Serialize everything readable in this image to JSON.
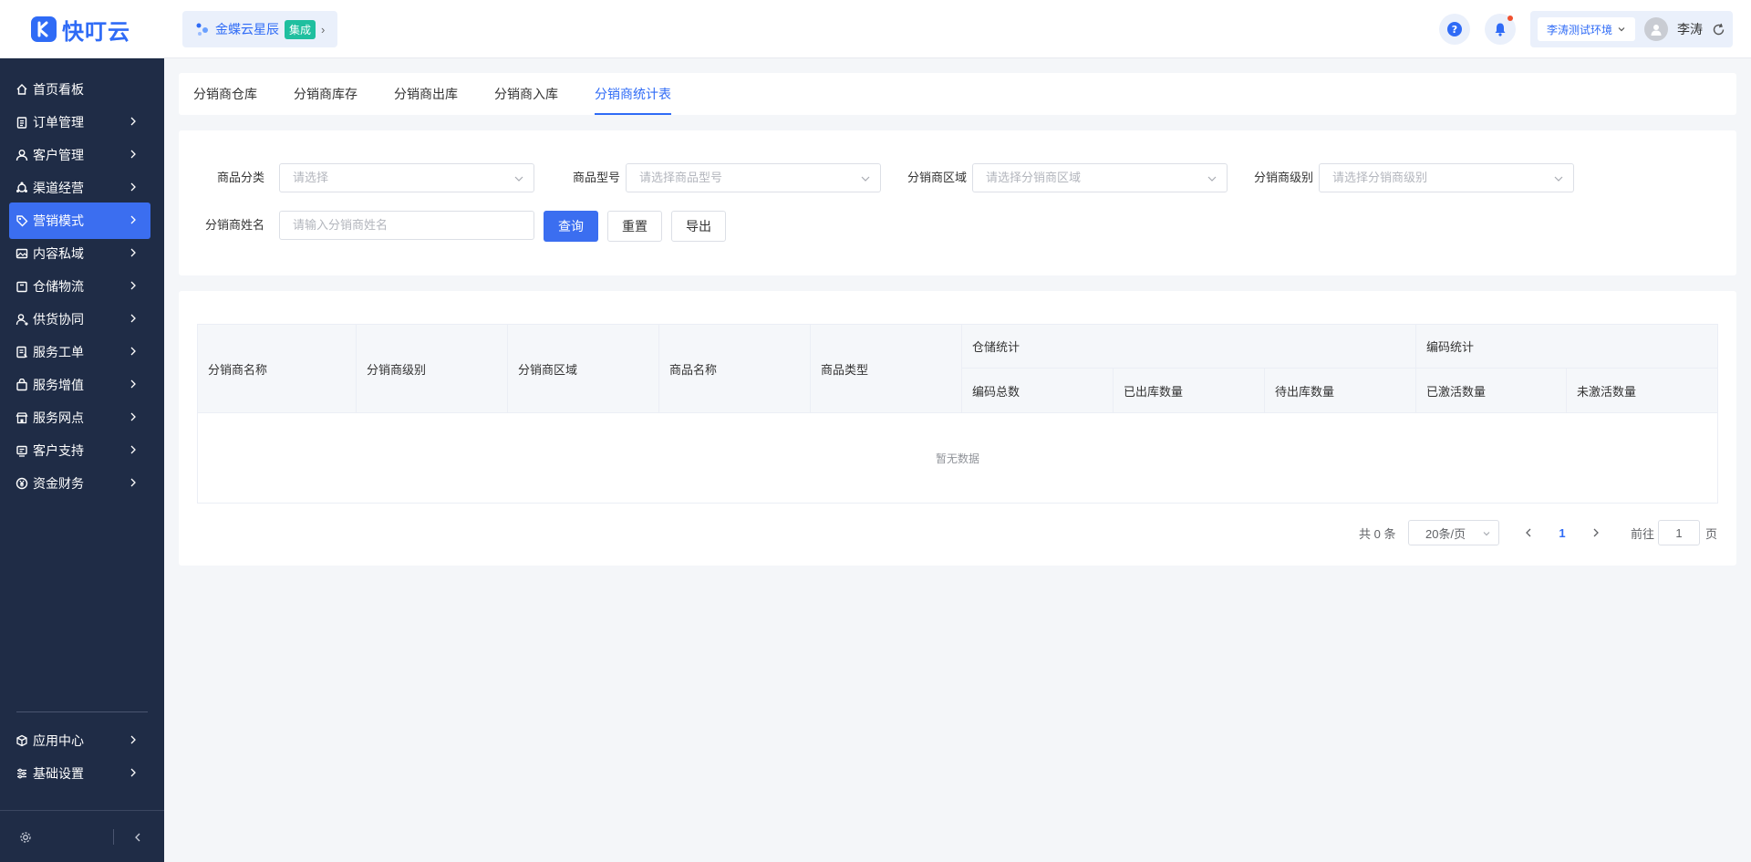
{
  "app": {
    "logo_text": "快叮云",
    "brand_color": "#2f6bf6"
  },
  "org_switcher": {
    "name": "金蝶云星辰",
    "tag": "集成"
  },
  "header": {
    "environment": "李涛测试环境",
    "user_name": "李涛"
  },
  "sidebar": {
    "items": [
      {
        "label": "首页看板",
        "icon": "home-icon"
      },
      {
        "label": "订单管理",
        "icon": "clipboard-icon"
      },
      {
        "label": "客户管理",
        "icon": "user-icon"
      },
      {
        "label": "渠道经营",
        "icon": "channel-icon"
      },
      {
        "label": "营销模式",
        "icon": "tag-icon",
        "active": true
      },
      {
        "label": "内容私域",
        "icon": "image-icon"
      },
      {
        "label": "仓储物流",
        "icon": "box-icon"
      },
      {
        "label": "供货协同",
        "icon": "user-share-icon"
      },
      {
        "label": "服务工单",
        "icon": "ticket-icon"
      },
      {
        "label": "服务增值",
        "icon": "bag-icon"
      },
      {
        "label": "服务网点",
        "icon": "store-icon"
      },
      {
        "label": "客户支持",
        "icon": "support-icon"
      },
      {
        "label": "资金财务",
        "icon": "yuan-icon"
      }
    ],
    "bottom_items": [
      {
        "label": "应用中心",
        "icon": "cube-icon"
      },
      {
        "label": "基础设置",
        "icon": "settings-icon"
      }
    ]
  },
  "tabs": [
    "分销商仓库",
    "分销商库存",
    "分销商出库",
    "分销商入库",
    "分销商统计表"
  ],
  "active_tab": 4,
  "filters": {
    "category": {
      "label": "商品分类",
      "placeholder": "请选择"
    },
    "model": {
      "label": "商品型号",
      "placeholder": "请选择商品型号"
    },
    "region": {
      "label": "分销商区域",
      "placeholder": "请选择分销商区域"
    },
    "level": {
      "label": "分销商级别",
      "placeholder": "请选择分销商级别"
    },
    "name": {
      "label": "分销商姓名",
      "placeholder": "请输入分销商姓名"
    },
    "query_button": "查询",
    "reset_button": "重置",
    "export_button": "导出"
  },
  "table": {
    "columns": [
      "分销商名称",
      "分销商级别",
      "分销商区域",
      "商品名称",
      "商品类型"
    ],
    "group_storage": {
      "label": "仓储统计",
      "children": [
        "编码总数",
        "已出库数量",
        "待出库数量"
      ]
    },
    "group_code": {
      "label": "编码统计",
      "children": [
        "已激活数量",
        "未激活数量"
      ]
    },
    "empty_text": "暂无数据"
  },
  "pagination": {
    "total": "共 0 条",
    "page_size": "20条/页",
    "current_page": "1",
    "goto_prefix": "前往",
    "goto_value": "1",
    "goto_suffix": "页"
  }
}
